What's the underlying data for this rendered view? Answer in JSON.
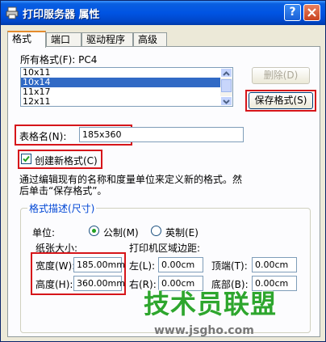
{
  "window": {
    "title": "打印服务器 属性",
    "help_label": "?"
  },
  "tabs": [
    "格式",
    "端口",
    "驱动程序",
    "高级"
  ],
  "formats_label": "所有格式(F): PC4",
  "format_list": [
    "10x11",
    "10x14",
    "11x17",
    "12x11"
  ],
  "selected_format": "10x14",
  "buttons": {
    "delete": "删除(D)",
    "save": "保存格式(S)"
  },
  "form_name": {
    "label": "表格名(N):",
    "value": "185x360"
  },
  "create_new": {
    "label": "创建新格式(C)",
    "checked": true
  },
  "description": {
    "line1": "通过编辑现有的名称和度量单位来定义新的格式。然",
    "line2": "后单击“保存格式”。"
  },
  "group": {
    "title": "格式描述(尺寸)",
    "unit_label": "单位:",
    "unit_metric": "公制(M)",
    "unit_imperial": "英制(E)",
    "paper_size_label": "纸张大小:",
    "margins_label": "打印机区域边距:",
    "width": {
      "label": "宽度(W):",
      "value": "185.00mm"
    },
    "height": {
      "label": "高度(H):",
      "value": "360.00mm"
    },
    "left": {
      "label": "左(L):",
      "value": "0.00cm"
    },
    "right": {
      "label": "右(R):",
      "value": "0.00cm"
    },
    "top": {
      "label": "顶端(T):",
      "value": "0.00cm"
    },
    "bottom": {
      "label": "底部(B):",
      "value": "0.00cm"
    }
  },
  "watermark": {
    "text": "技术员联盟",
    "url": "www.jsgho.com"
  },
  "colors": {
    "highlight": "#d6151a",
    "titlebar": "#0054e3",
    "group_title": "#0046d5"
  }
}
